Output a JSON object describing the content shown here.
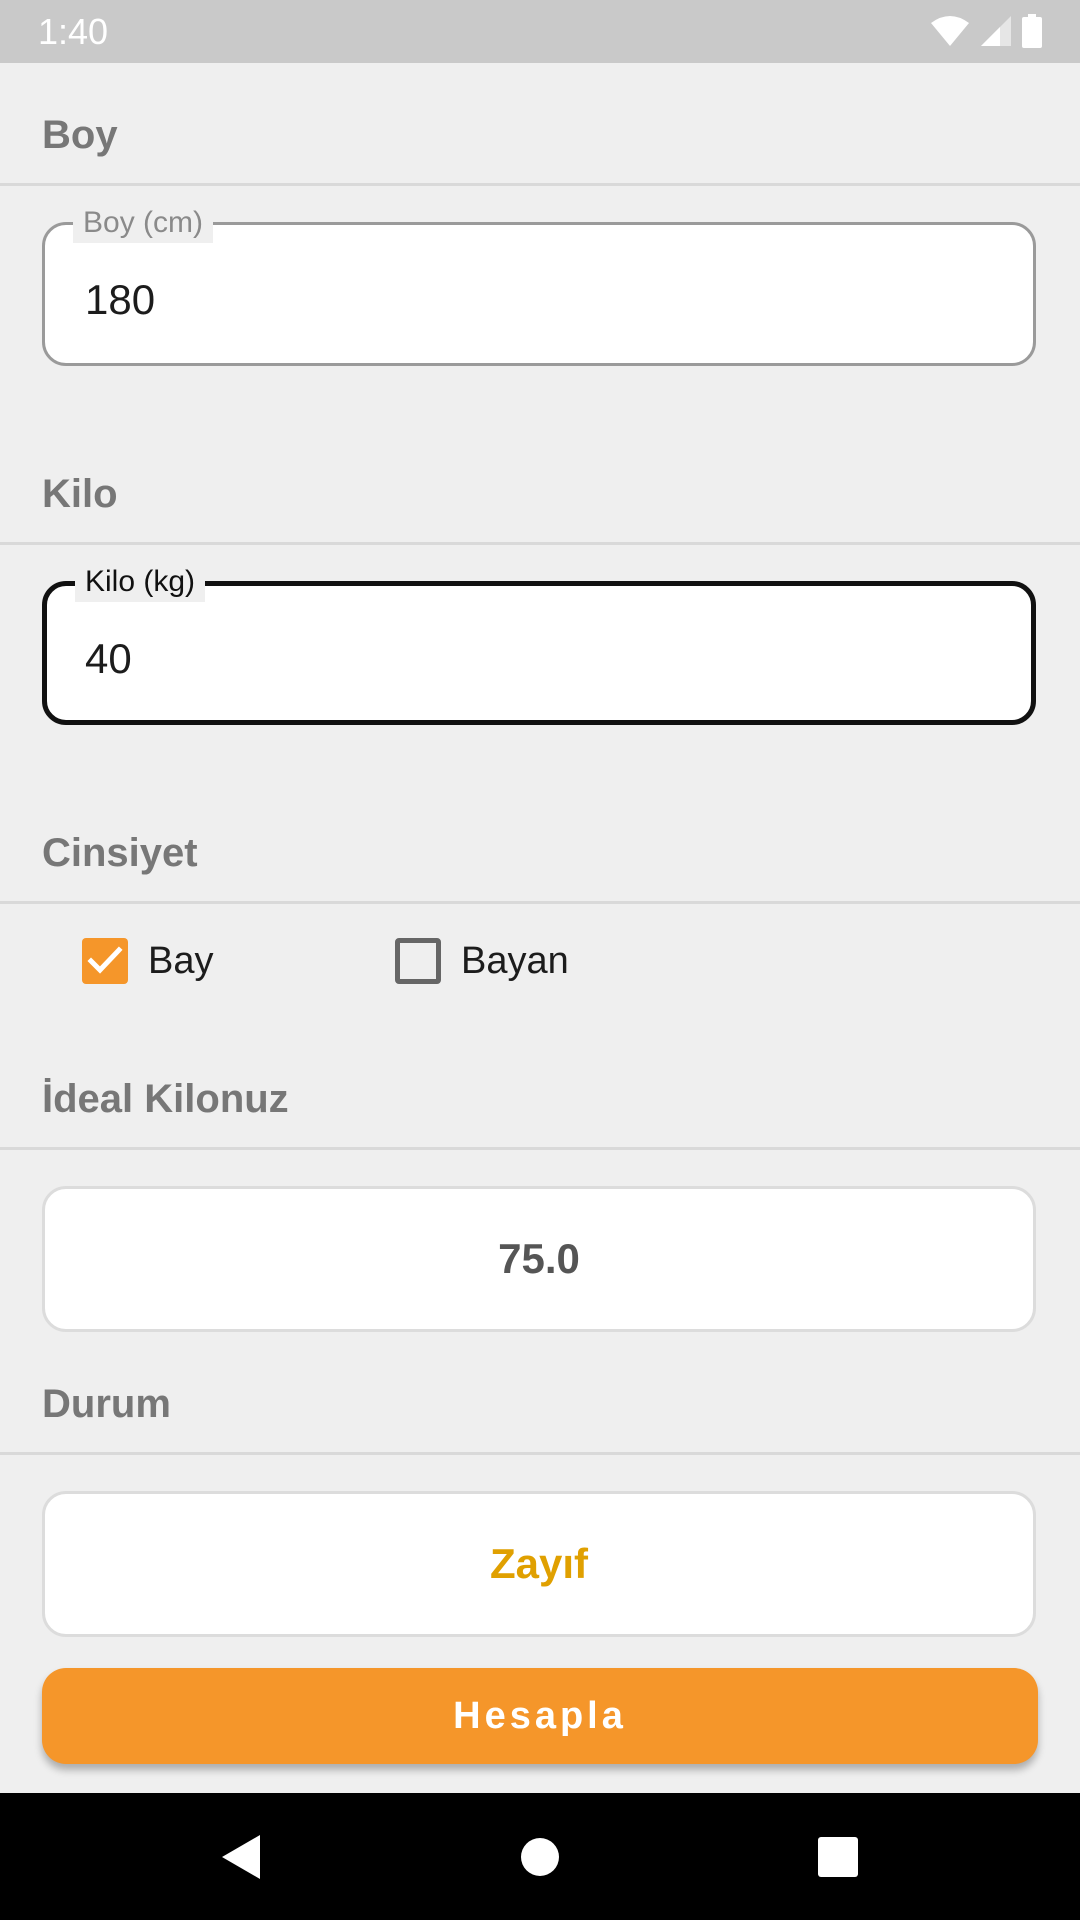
{
  "status_bar": {
    "time": "1:40"
  },
  "sections": {
    "height": {
      "title": "Boy",
      "field_label": "Boy (cm)",
      "field_value": "180"
    },
    "weight": {
      "title": "Kilo",
      "field_label": "Kilo (kg)",
      "field_value": "40"
    },
    "gender": {
      "title": "Cinsiyet",
      "options": [
        {
          "label": "Bay",
          "checked": true
        },
        {
          "label": "Bayan",
          "checked": false
        }
      ]
    },
    "ideal_weight": {
      "title": "İdeal Kilonuz",
      "value": "75.0"
    },
    "status": {
      "title": "Durum",
      "value": "Zayıf"
    }
  },
  "calculate_button": {
    "label": "Hesapla"
  },
  "colors": {
    "accent": "#f5962a",
    "status_text": "#e0a000",
    "ideal_value_text": "#555555",
    "section_title": "#777777"
  },
  "icons": {
    "status": [
      "wifi-icon",
      "signal-icon",
      "battery-icon"
    ],
    "nav": [
      "back-icon",
      "home-icon",
      "recents-icon"
    ],
    "checkbox_checked": "checkmark-icon"
  }
}
